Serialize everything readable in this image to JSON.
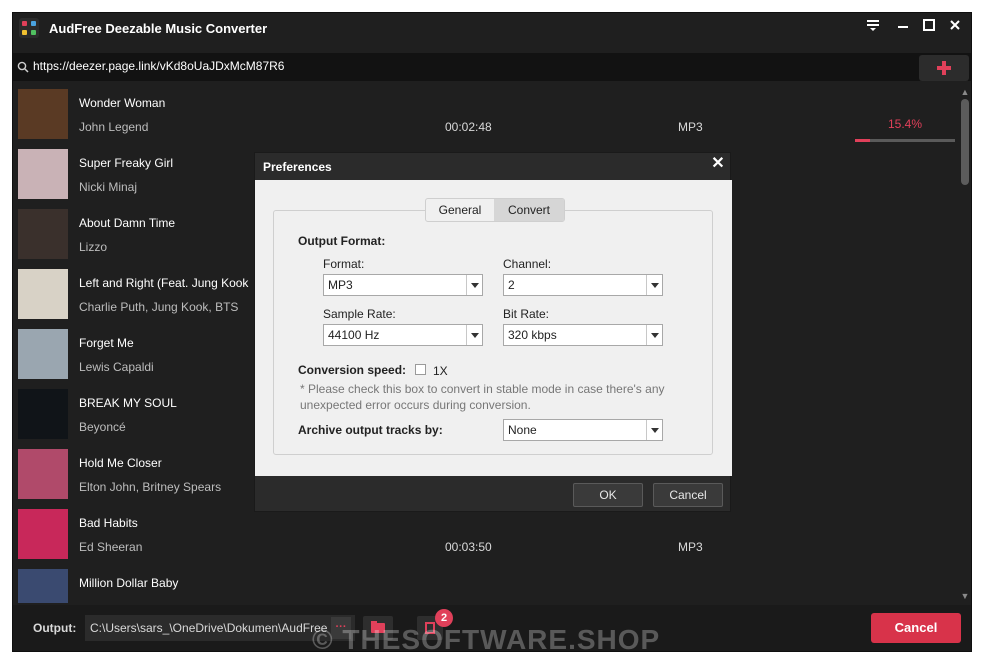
{
  "app": {
    "title": "AudFree Deezable Music Converter"
  },
  "url_bar": {
    "url": "https://deezer.page.link/vKd8oUaJDxMcM87R6"
  },
  "tracks": [
    {
      "title": "Wonder Woman",
      "artist": "John Legend",
      "duration": "00:02:48",
      "format": "MP3",
      "progress_text": "15.4%",
      "progress": 0.154,
      "cover_color": "#5a3a24"
    },
    {
      "title": "Super Freaky Girl",
      "artist": "Nicki Minaj",
      "duration": "",
      "format": "",
      "cover_color": "#c9b2b6"
    },
    {
      "title": "About Damn Time",
      "artist": "Lizzo",
      "duration": "",
      "format": "",
      "cover_color": "#3a302c"
    },
    {
      "title": "Left and Right (Feat. Jung Kook",
      "artist": "Charlie Puth, Jung Kook, BTS",
      "duration": "",
      "format": "",
      "cover_color": "#d8d2c6"
    },
    {
      "title": "Forget Me",
      "artist": "Lewis Capaldi",
      "duration": "",
      "format": "",
      "cover_color": "#9aa6b0"
    },
    {
      "title": "BREAK MY SOUL",
      "artist": "Beyoncé",
      "duration": "",
      "format": "",
      "cover_color": "#101418"
    },
    {
      "title": "Hold Me Closer",
      "artist": "Elton John, Britney Spears",
      "duration": "",
      "format": "",
      "cover_color": "#b04a6a"
    },
    {
      "title": "Bad Habits",
      "artist": "Ed Sheeran",
      "duration": "00:03:50",
      "format": "MP3",
      "cover_color": "#c8285a"
    },
    {
      "title": "Million Dollar Baby",
      "artist": "",
      "duration": "",
      "format": "",
      "cover_color": "#3a4a70"
    }
  ],
  "footer": {
    "output_label": "Output:",
    "output_path": "C:\\Users\\sars_\\OneDrive\\Dokumen\\AudFree",
    "more_label": "···",
    "badge_count": "2",
    "cancel_label": "Cancel"
  },
  "watermark": "© THESOFTWARE.SHOP",
  "dialog": {
    "title": "Preferences",
    "tabs": [
      "General",
      "Convert"
    ],
    "active_tab": "Convert",
    "output_format_label": "Output Format:",
    "format_label": "Format:",
    "format_value": "MP3",
    "channel_label": "Channel:",
    "channel_value": "2",
    "sample_rate_label": "Sample Rate:",
    "sample_rate_value": "44100 Hz",
    "bit_rate_label": "Bit Rate:",
    "bit_rate_value": "320 kbps",
    "conversion_speed_label": "Conversion speed:",
    "speed_option_label": "1X",
    "speed_checked": false,
    "note": "* Please check this box to convert in stable mode in case there's any unexpected error occurs during conversion.",
    "archive_label": "Archive output tracks by:",
    "archive_value": "None",
    "ok_label": "OK",
    "cancel_label": "Cancel"
  },
  "colors": {
    "accent": "#e0405a",
    "window_bg": "#1f1f1f",
    "dialog_body": "#f0f0f0"
  },
  "icons": [
    "app-logo-icon",
    "menu-icon",
    "minimize-icon",
    "maximize-icon",
    "close-icon",
    "search-icon",
    "plus-icon",
    "folder-icon",
    "history-icon"
  ]
}
